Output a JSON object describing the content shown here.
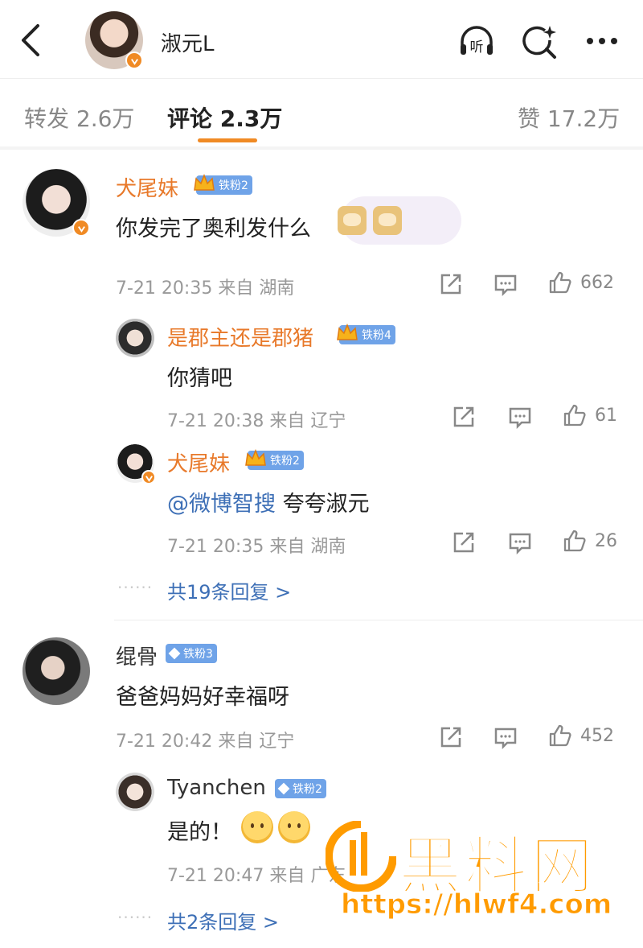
{
  "header": {
    "title": "淑元L",
    "icons": [
      "back-chevron-icon",
      "listen-icon",
      "ai-search-icon",
      "more-icon"
    ],
    "listen_label": "听"
  },
  "tabs": [
    {
      "label": "转发 2.6万",
      "active": false
    },
    {
      "label": "评论 2.3万",
      "active": true
    },
    {
      "label": "赞 17.2万",
      "active": false
    }
  ],
  "colors": {
    "accent": "#f08a24",
    "name_orange": "#e8792a",
    "link_blue": "#3d6fb6",
    "badge_blue": "#6fa3e8"
  },
  "comments": [
    {
      "user": "犬尾妹",
      "badge": "铁粉2",
      "text": "你发完了奥利发什么",
      "time": "7-21 20:35",
      "location": "来自 湖南",
      "likes": "662",
      "replies": [
        {
          "user": "是郡主还是郡猪",
          "badge": "铁粉4",
          "text": "你猜吧",
          "time": "7-21 20:38",
          "location": "来自 辽宁",
          "likes": "61"
        },
        {
          "user": "犬尾妹",
          "badge": "铁粉2",
          "mention": "@微博智搜",
          "text": "夸夸淑元",
          "time": "7-21 20:35",
          "location": "来自 湖南",
          "likes": "26"
        }
      ],
      "more_replies": "共19条回复 >"
    },
    {
      "user": "绲骨",
      "badge": "铁粉3",
      "text": "爸爸妈妈好幸福呀",
      "time": "7-21 20:42",
      "location": "来自 辽宁",
      "likes": "452",
      "replies": [
        {
          "user": "Tyanchen",
          "badge": "铁粉2",
          "text": "是的！",
          "time": "7-21 20:47",
          "location": "来自 广东"
        }
      ],
      "more_replies": "共2条回复 >"
    }
  ],
  "watermark": {
    "text": "黑料网",
    "url": "https://hlwf4.com"
  }
}
